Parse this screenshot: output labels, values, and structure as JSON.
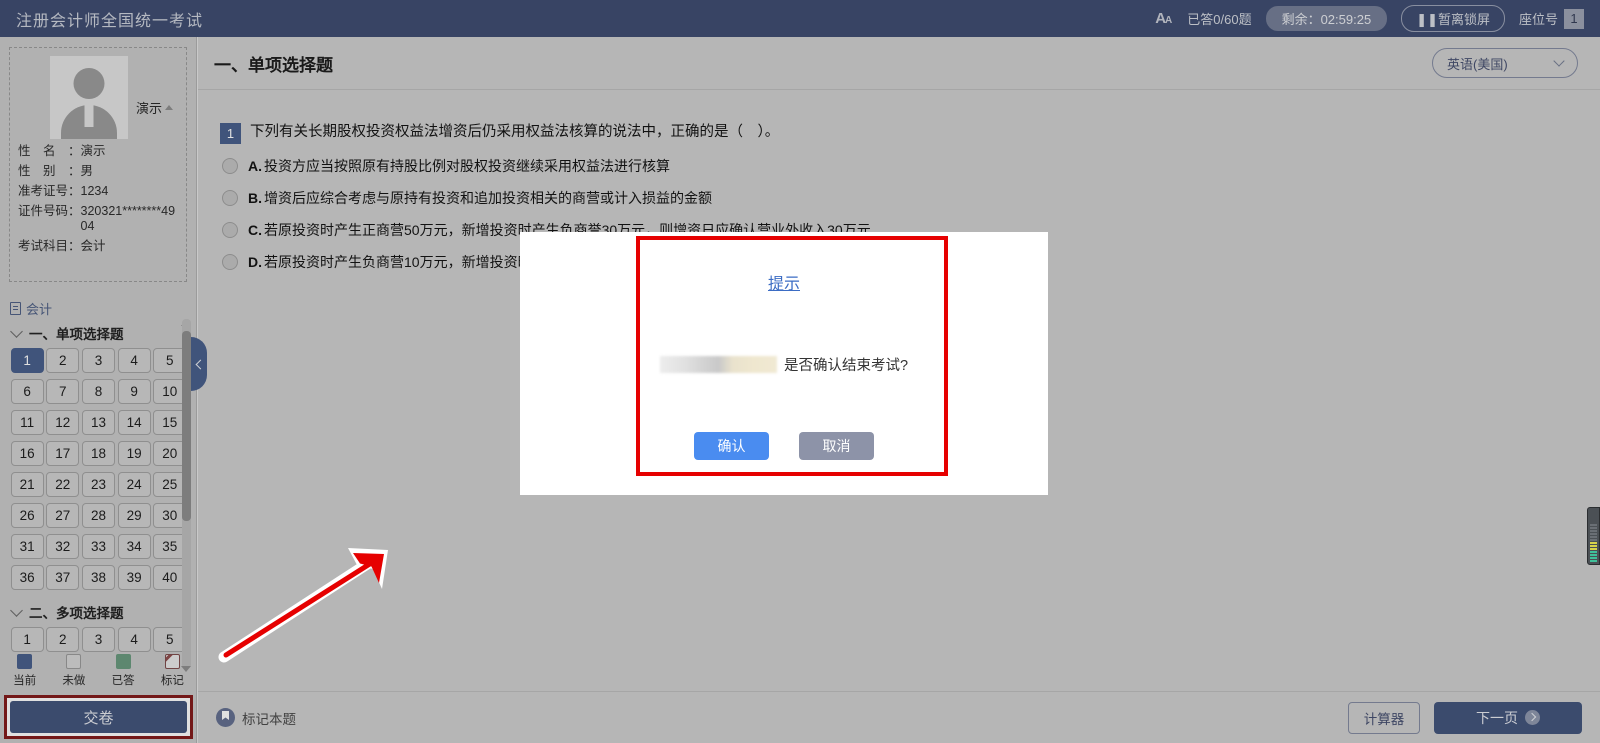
{
  "header": {
    "brand": "注册会计师全国统一考试",
    "font_icon": "font-size-icon",
    "answered": "已答0/60题",
    "timer": "剩余：02:59:25",
    "lock_button": "❚❚暂离锁屏",
    "seat_label": "座位号",
    "seat_number": "1"
  },
  "sidebar": {
    "user": {
      "name_toggle": "演示",
      "fields": [
        {
          "label": "性　名　：",
          "value": "演示"
        },
        {
          "label": "性　别　：",
          "value": "男"
        },
        {
          "label": "准考证号：",
          "value": "1234"
        },
        {
          "label": "证件号码：",
          "value": "320321********4904"
        },
        {
          "label": "考试科目：",
          "value": "会计"
        }
      ]
    },
    "subject": "会计",
    "sections": [
      {
        "title": "一、单项选择题",
        "questions": [
          1,
          2,
          3,
          4,
          5,
          6,
          7,
          8,
          9,
          10,
          11,
          12,
          13,
          14,
          15,
          16,
          17,
          18,
          19,
          20,
          21,
          22,
          23,
          24,
          25,
          26,
          27,
          28,
          29,
          30,
          31,
          32,
          33,
          34,
          35,
          36,
          37,
          38,
          39,
          40
        ],
        "current": 1
      },
      {
        "title": "二、多项选择题",
        "questions": [
          1,
          2,
          3,
          4,
          5
        ],
        "current": 0
      }
    ],
    "legend": [
      {
        "label": "当前",
        "kind": "cur"
      },
      {
        "label": "未做",
        "kind": "undone"
      },
      {
        "label": "已答",
        "kind": "done"
      },
      {
        "label": "标记",
        "kind": "marked"
      }
    ],
    "submit_label": "交卷"
  },
  "main": {
    "section_title": "一、单项选择题",
    "language": "英语(美国)",
    "question": {
      "number": "1",
      "stem": "下列有关长期股权投资权益法增资后仍采用权益法核算的说法中，正确的是（　）。",
      "options": [
        {
          "letter": "A.",
          "text": "投资方应当按照原有持股比例对股权投资继续采用权益法进行核算"
        },
        {
          "letter": "B.",
          "text": "增资后应综合考虑与原持有投资和追加投资相关的商营或计入损益的金额"
        },
        {
          "letter": "C.",
          "text": "若原投资时产生正商营50万元，新增投资时产生负商誉30万元，则增资日应确认营业外收入30万元"
        },
        {
          "letter": "D.",
          "text": "若原投资时产生负商营10万元，新增投资时"
        }
      ]
    },
    "bottom": {
      "mark_label": "标记本题",
      "calculator_label": "计算器",
      "next_label": "下一页"
    }
  },
  "modal": {
    "title": "提示",
    "message": "是否确认结束考试?",
    "confirm_label": "确认",
    "cancel_label": "取消"
  },
  "colors": {
    "brand_blue": "#2f4e9e",
    "accent_blue": "#2f62c4",
    "annotation_red": "#e60000",
    "confirm_blue": "#4a8cf0",
    "cancel_grey": "#8d93a8"
  }
}
